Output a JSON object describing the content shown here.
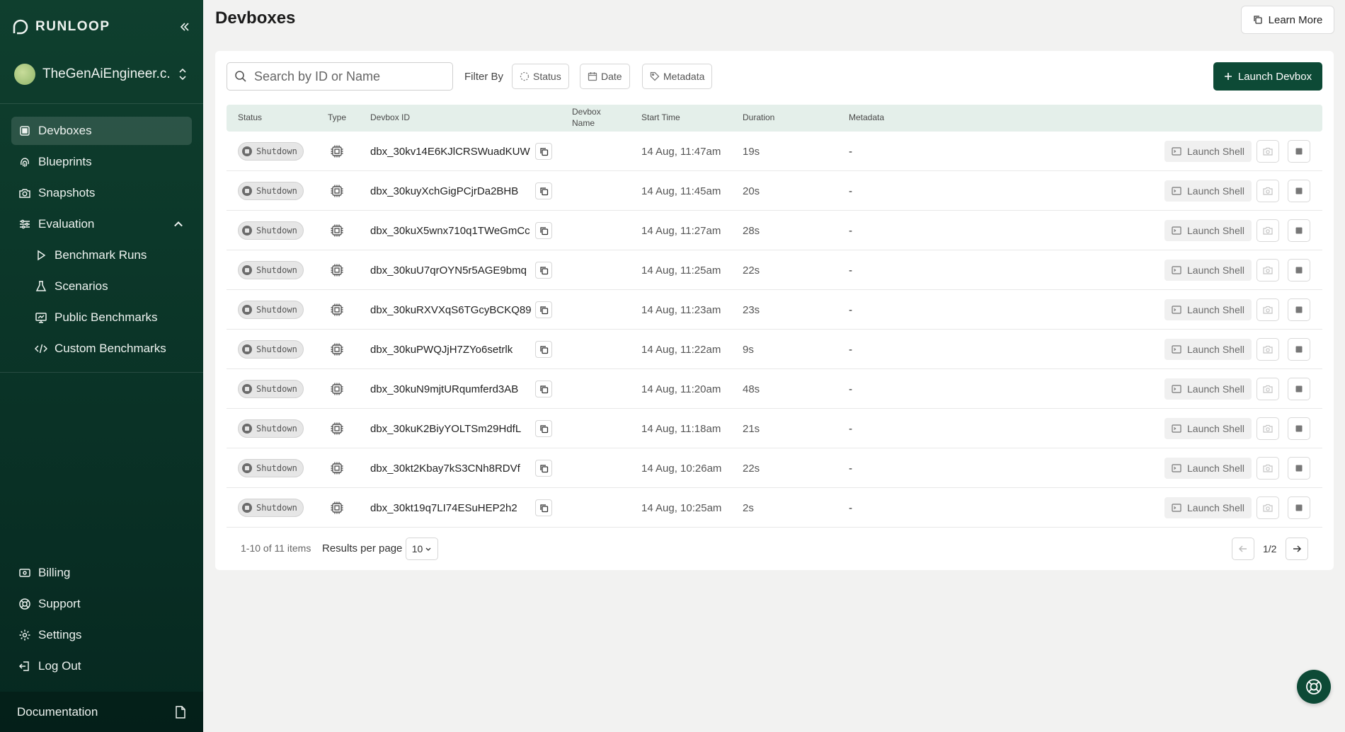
{
  "brand": {
    "name": "RUNLOOP"
  },
  "org": {
    "name": "TheGenAiEngineer.c..."
  },
  "nav": {
    "devboxes": "Devboxes",
    "blueprints": "Blueprints",
    "snapshots": "Snapshots",
    "evaluation": "Evaluation",
    "benchmark_runs": "Benchmark Runs",
    "scenarios": "Scenarios",
    "public_benchmarks": "Public Benchmarks",
    "custom_benchmarks": "Custom Benchmarks",
    "billing": "Billing",
    "support": "Support",
    "settings": "Settings",
    "logout": "Log Out",
    "documentation": "Documentation"
  },
  "header": {
    "title": "Devboxes",
    "learn_more": "Learn More"
  },
  "toolbar": {
    "search_placeholder": "Search by ID or Name",
    "filter_by": "Filter By",
    "filter_status": "Status",
    "filter_date": "Date",
    "filter_metadata": "Metadata",
    "launch_devbox": "Launch Devbox"
  },
  "table": {
    "columns": {
      "status": "Status",
      "type": "Type",
      "devbox_id": "Devbox ID",
      "devbox_name_1": "Devbox",
      "devbox_name_2": "Name",
      "start_time": "Start Time",
      "duration": "Duration",
      "metadata": "Metadata"
    },
    "rows": [
      {
        "status": "Shutdown",
        "id": "dbx_30kv14E6KJlCRSWuadKUW",
        "start": "14 Aug, 11:47am",
        "duration": "19s",
        "metadata": "-",
        "action": "Launch Shell"
      },
      {
        "status": "Shutdown",
        "id": "dbx_30kuyXchGigPCjrDa2BHB",
        "start": "14 Aug, 11:45am",
        "duration": "20s",
        "metadata": "-",
        "action": "Launch Shell"
      },
      {
        "status": "Shutdown",
        "id": "dbx_30kuX5wnx710q1TWeGmCc",
        "start": "14 Aug, 11:27am",
        "duration": "28s",
        "metadata": "-",
        "action": "Launch Shell"
      },
      {
        "status": "Shutdown",
        "id": "dbx_30kuU7qrOYN5r5AGE9bmq",
        "start": "14 Aug, 11:25am",
        "duration": "22s",
        "metadata": "-",
        "action": "Launch Shell"
      },
      {
        "status": "Shutdown",
        "id": "dbx_30kuRXVXqS6TGcyBCKQ89",
        "start": "14 Aug, 11:23am",
        "duration": "23s",
        "metadata": "-",
        "action": "Launch Shell"
      },
      {
        "status": "Shutdown",
        "id": "dbx_30kuPWQJjH7ZYo6setrlk",
        "start": "14 Aug, 11:22am",
        "duration": "9s",
        "metadata": "-",
        "action": "Launch Shell"
      },
      {
        "status": "Shutdown",
        "id": "dbx_30kuN9mjtURqumferd3AB",
        "start": "14 Aug, 11:20am",
        "duration": "48s",
        "metadata": "-",
        "action": "Launch Shell"
      },
      {
        "status": "Shutdown",
        "id": "dbx_30kuK2BiyYOLTSm29HdfL",
        "start": "14 Aug, 11:18am",
        "duration": "21s",
        "metadata": "-",
        "action": "Launch Shell"
      },
      {
        "status": "Shutdown",
        "id": "dbx_30kt2Kbay7kS3CNh8RDVf",
        "start": "14 Aug, 10:26am",
        "duration": "22s",
        "metadata": "-",
        "action": "Launch Shell"
      },
      {
        "status": "Shutdown",
        "id": "dbx_30kt19q7LI74ESuHEP2h2",
        "start": "14 Aug, 10:25am",
        "duration": "2s",
        "metadata": "-",
        "action": "Launch Shell"
      }
    ]
  },
  "pagination": {
    "count": "1-10 of 11 items",
    "results_per_page": "Results per page",
    "per_page_value": "10",
    "page": "1/2"
  },
  "colors": {
    "brand": "#0d4a36",
    "sidebar": "#0b3528",
    "header_row": "#e4efea"
  }
}
